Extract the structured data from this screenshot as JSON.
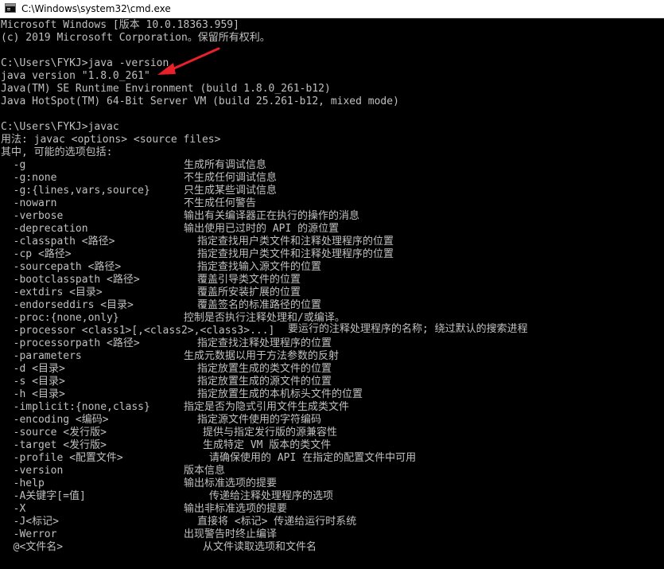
{
  "window": {
    "title": "C:\\Windows\\system32\\cmd.exe",
    "icon": "cmd-icon"
  },
  "console": {
    "header": [
      "Microsoft Windows [版本 10.0.18363.959]",
      "(c) 2019 Microsoft Corporation。保留所有权利。"
    ],
    "version_block": [
      "C:\\Users\\FYKJ>java -version",
      "java version \"1.8.0_261\"",
      "Java(TM) SE Runtime Environment (build 1.8.0_261-b12)",
      "Java HotSpot(TM) 64-Bit Server VM (build 25.261-b12, mixed mode)"
    ],
    "javac_block": [
      "C:\\Users\\FYKJ>javac",
      "用法: javac <options> <source files>",
      "其中, 可能的选项包括:"
    ],
    "options": [
      {
        "flag": "  -g",
        "desc": "生成所有调试信息"
      },
      {
        "flag": "  -g:none",
        "desc": "不生成任何调试信息"
      },
      {
        "flag": "  -g:{lines,vars,source}",
        "desc": "只生成某些调试信息"
      },
      {
        "flag": "  -nowarn",
        "desc": "不生成任何警告"
      },
      {
        "flag": "  -verbose",
        "desc": "输出有关编译器正在执行的操作的消息"
      },
      {
        "flag": "  -deprecation",
        "desc": "输出使用已过时的 API 的源位置"
      },
      {
        "flag": "  -classpath <路径>",
        "desc": "指定查找用户类文件和注释处理程序的位置"
      },
      {
        "flag": "  -cp <路径>",
        "desc": "指定查找用户类文件和注释处理程序的位置"
      },
      {
        "flag": "  -sourcepath <路径>",
        "desc": "指定查找输入源文件的位置"
      },
      {
        "flag": "  -bootclasspath <路径>",
        "desc": "覆盖引导类文件的位置"
      },
      {
        "flag": "  -extdirs <目录>",
        "desc": "覆盖所安装扩展的位置"
      },
      {
        "flag": "  -endorseddirs <目录>",
        "desc": "覆盖签名的标准路径的位置"
      },
      {
        "flag": "  -proc:{none,only}",
        "desc": "控制是否执行注释处理和/或编译。"
      },
      {
        "flag": "  -processor <class1>[,<class2>,<class3>...]",
        "desc": "要运行的注释处理程序的名称; 绕过默认的搜索进程"
      },
      {
        "flag": "  -processorpath <路径>",
        "desc": "指定查找注释处理程序的位置"
      },
      {
        "flag": "  -parameters",
        "desc": "生成元数据以用于方法参数的反射"
      },
      {
        "flag": "  -d <目录>",
        "desc": "指定放置生成的类文件的位置"
      },
      {
        "flag": "  -s <目录>",
        "desc": "指定放置生成的源文件的位置"
      },
      {
        "flag": "  -h <目录>",
        "desc": "指定放置生成的本机标头文件的位置"
      },
      {
        "flag": "  -implicit:{none,class}",
        "desc": "指定是否为隐式引用文件生成类文件"
      },
      {
        "flag": "  -encoding <编码>",
        "desc": "指定源文件使用的字符编码"
      },
      {
        "flag": "  -source <发行版>",
        "desc": "提供与指定发行版的源兼容性"
      },
      {
        "flag": "  -target <发行版>",
        "desc": "生成特定 VM 版本的类文件"
      },
      {
        "flag": "  -profile <配置文件>",
        "desc": "请确保使用的 API 在指定的配置文件中可用"
      },
      {
        "flag": "  -version",
        "desc": "版本信息"
      },
      {
        "flag": "  -help",
        "desc": "输出标准选项的提要"
      },
      {
        "flag": "  -A关键字[=值]",
        "desc": "传递给注释处理程序的选项"
      },
      {
        "flag": "  -X",
        "desc": "输出非标准选项的提要"
      },
      {
        "flag": "  -J<标记>",
        "desc": "直接将 <标记> 传递给运行时系统"
      },
      {
        "flag": "  -Werror",
        "desc": "出现警告时终止编译"
      },
      {
        "flag": "  @<文件名>",
        "desc": "从文件读取选项和文件名"
      }
    ]
  },
  "annotation": {
    "arrow_color": "#e8202a",
    "target": "java-version-line"
  },
  "colors": {
    "console_text": "#c0c0c0",
    "console_bg": "#000000",
    "titlebar_bg": "#ffffff"
  }
}
